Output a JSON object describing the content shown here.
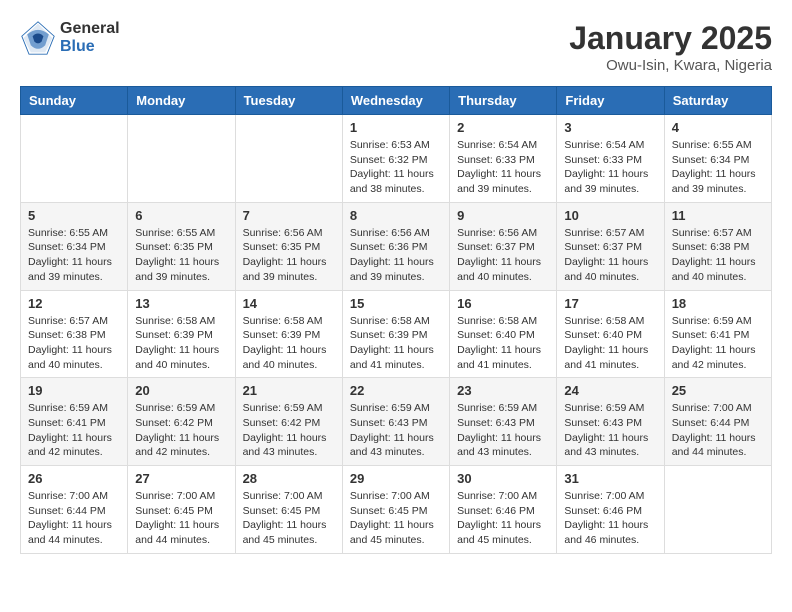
{
  "header": {
    "logo": {
      "general": "General",
      "blue": "Blue"
    },
    "title": "January 2025",
    "subtitle": "Owu-Isin, Kwara, Nigeria"
  },
  "weekdays": [
    "Sunday",
    "Monday",
    "Tuesday",
    "Wednesday",
    "Thursday",
    "Friday",
    "Saturday"
  ],
  "weeks": [
    [
      {
        "day": "",
        "info": ""
      },
      {
        "day": "",
        "info": ""
      },
      {
        "day": "",
        "info": ""
      },
      {
        "day": "1",
        "info": "Sunrise: 6:53 AM\nSunset: 6:32 PM\nDaylight: 11 hours and 38 minutes."
      },
      {
        "day": "2",
        "info": "Sunrise: 6:54 AM\nSunset: 6:33 PM\nDaylight: 11 hours and 39 minutes."
      },
      {
        "day": "3",
        "info": "Sunrise: 6:54 AM\nSunset: 6:33 PM\nDaylight: 11 hours and 39 minutes."
      },
      {
        "day": "4",
        "info": "Sunrise: 6:55 AM\nSunset: 6:34 PM\nDaylight: 11 hours and 39 minutes."
      }
    ],
    [
      {
        "day": "5",
        "info": "Sunrise: 6:55 AM\nSunset: 6:34 PM\nDaylight: 11 hours and 39 minutes."
      },
      {
        "day": "6",
        "info": "Sunrise: 6:55 AM\nSunset: 6:35 PM\nDaylight: 11 hours and 39 minutes."
      },
      {
        "day": "7",
        "info": "Sunrise: 6:56 AM\nSunset: 6:35 PM\nDaylight: 11 hours and 39 minutes."
      },
      {
        "day": "8",
        "info": "Sunrise: 6:56 AM\nSunset: 6:36 PM\nDaylight: 11 hours and 39 minutes."
      },
      {
        "day": "9",
        "info": "Sunrise: 6:56 AM\nSunset: 6:37 PM\nDaylight: 11 hours and 40 minutes."
      },
      {
        "day": "10",
        "info": "Sunrise: 6:57 AM\nSunset: 6:37 PM\nDaylight: 11 hours and 40 minutes."
      },
      {
        "day": "11",
        "info": "Sunrise: 6:57 AM\nSunset: 6:38 PM\nDaylight: 11 hours and 40 minutes."
      }
    ],
    [
      {
        "day": "12",
        "info": "Sunrise: 6:57 AM\nSunset: 6:38 PM\nDaylight: 11 hours and 40 minutes."
      },
      {
        "day": "13",
        "info": "Sunrise: 6:58 AM\nSunset: 6:39 PM\nDaylight: 11 hours and 40 minutes."
      },
      {
        "day": "14",
        "info": "Sunrise: 6:58 AM\nSunset: 6:39 PM\nDaylight: 11 hours and 40 minutes."
      },
      {
        "day": "15",
        "info": "Sunrise: 6:58 AM\nSunset: 6:39 PM\nDaylight: 11 hours and 41 minutes."
      },
      {
        "day": "16",
        "info": "Sunrise: 6:58 AM\nSunset: 6:40 PM\nDaylight: 11 hours and 41 minutes."
      },
      {
        "day": "17",
        "info": "Sunrise: 6:58 AM\nSunset: 6:40 PM\nDaylight: 11 hours and 41 minutes."
      },
      {
        "day": "18",
        "info": "Sunrise: 6:59 AM\nSunset: 6:41 PM\nDaylight: 11 hours and 42 minutes."
      }
    ],
    [
      {
        "day": "19",
        "info": "Sunrise: 6:59 AM\nSunset: 6:41 PM\nDaylight: 11 hours and 42 minutes."
      },
      {
        "day": "20",
        "info": "Sunrise: 6:59 AM\nSunset: 6:42 PM\nDaylight: 11 hours and 42 minutes."
      },
      {
        "day": "21",
        "info": "Sunrise: 6:59 AM\nSunset: 6:42 PM\nDaylight: 11 hours and 43 minutes."
      },
      {
        "day": "22",
        "info": "Sunrise: 6:59 AM\nSunset: 6:43 PM\nDaylight: 11 hours and 43 minutes."
      },
      {
        "day": "23",
        "info": "Sunrise: 6:59 AM\nSunset: 6:43 PM\nDaylight: 11 hours and 43 minutes."
      },
      {
        "day": "24",
        "info": "Sunrise: 6:59 AM\nSunset: 6:43 PM\nDaylight: 11 hours and 43 minutes."
      },
      {
        "day": "25",
        "info": "Sunrise: 7:00 AM\nSunset: 6:44 PM\nDaylight: 11 hours and 44 minutes."
      }
    ],
    [
      {
        "day": "26",
        "info": "Sunrise: 7:00 AM\nSunset: 6:44 PM\nDaylight: 11 hours and 44 minutes."
      },
      {
        "day": "27",
        "info": "Sunrise: 7:00 AM\nSunset: 6:45 PM\nDaylight: 11 hours and 44 minutes."
      },
      {
        "day": "28",
        "info": "Sunrise: 7:00 AM\nSunset: 6:45 PM\nDaylight: 11 hours and 45 minutes."
      },
      {
        "day": "29",
        "info": "Sunrise: 7:00 AM\nSunset: 6:45 PM\nDaylight: 11 hours and 45 minutes."
      },
      {
        "day": "30",
        "info": "Sunrise: 7:00 AM\nSunset: 6:46 PM\nDaylight: 11 hours and 45 minutes."
      },
      {
        "day": "31",
        "info": "Sunrise: 7:00 AM\nSunset: 6:46 PM\nDaylight: 11 hours and 46 minutes."
      },
      {
        "day": "",
        "info": ""
      }
    ]
  ]
}
